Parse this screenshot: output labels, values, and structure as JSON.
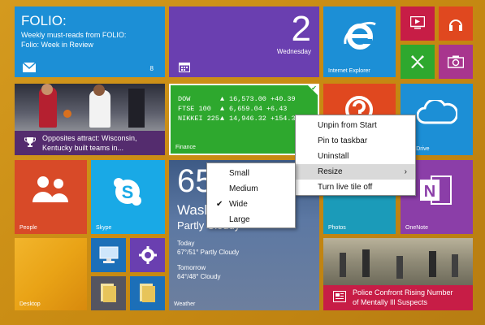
{
  "folio": {
    "title": "FOLIO:",
    "line1": "Weekly must-reads from FOLIO:",
    "line2": "Folio: Week in Review",
    "count": "8"
  },
  "calendar": {
    "day_number": "2",
    "day_name": "Wednesday"
  },
  "ie": {
    "label": "Internet Explorer"
  },
  "sports": {
    "line1": "Opposites attract: Wisconsin,",
    "line2": "Kentucky built teams in..."
  },
  "finance": {
    "label": "Finance",
    "rows": [
      {
        "name": "DOW",
        "arrow": "▲",
        "value": "16,573.00 +40.39"
      },
      {
        "name": "FTSE 100",
        "arrow": "▲",
        "value": "6,659.04 +6.43"
      },
      {
        "name": "NIKKEI 225",
        "arrow": "▲",
        "value": "14,946.32 +154.33"
      }
    ]
  },
  "onedrive": {
    "label": "OneDrive"
  },
  "people": {
    "label": "People"
  },
  "skype": {
    "label": "Skype"
  },
  "weather": {
    "temp": "65",
    "city": "Wash",
    "condition": "Partly Cloudy",
    "today_label": "Today",
    "today_value": "67°/51° Partly Cloudy",
    "tomorrow_label": "Tomorrow",
    "tomorrow_value": "64°/48° Cloudy",
    "label": "Weather"
  },
  "photos": {
    "label": "Photos"
  },
  "onenote": {
    "label": "OneNote"
  },
  "desktop": {
    "label": "Desktop"
  },
  "news": {
    "line1": "Police Confront Rising Number",
    "line2": "of Mentally Ill Suspects"
  },
  "context_menu": {
    "items": [
      {
        "label": "Unpin from Start"
      },
      {
        "label": "Pin to taskbar"
      },
      {
        "label": "Uninstall"
      },
      {
        "label": "Resize",
        "submenu_arrow": "›"
      },
      {
        "label": "Turn live tile off"
      }
    ]
  },
  "resize_menu": {
    "items": [
      {
        "label": "Small"
      },
      {
        "label": "Medium"
      },
      {
        "label": "Wide",
        "checked": "✔"
      },
      {
        "label": "Large"
      }
    ]
  },
  "colors": {
    "background": "#c88a12",
    "folio": "#1c8fd6",
    "calendar": "#6a3fb0",
    "ie": "#1c8fd6",
    "finance": "#2ea82e",
    "onedrive": "#1c8fd6",
    "people": "#d84a28",
    "skype": "#19a9e6",
    "photos": "#1b9bb9",
    "onenote": "#8b3ea8",
    "desktop": "#e9a316",
    "news": "#c71d46"
  }
}
